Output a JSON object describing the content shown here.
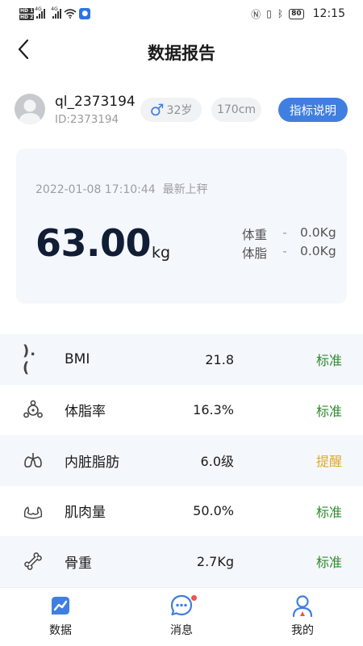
{
  "status_bar": {
    "hd1": "HD 1",
    "hd2": "HD 2",
    "net1": "4G",
    "net2": "4G",
    "battery": "80",
    "time": "12:15"
  },
  "header": {
    "title": "数据报告",
    "back_icon": "chevron-left-icon"
  },
  "profile": {
    "username": "ql_2373194",
    "user_id": "ID:2373194",
    "gender_symbol": "♂",
    "age": "32岁",
    "height": "170cm",
    "explain_button": "指标说明"
  },
  "weight_card": {
    "measure_time": "2022-01-08 17:10:44  最新上秤",
    "weight_value": "63.00",
    "weight_unit": "kg",
    "metrics": [
      {
        "label": "体重",
        "dash": "-",
        "value": "0.0Kg"
      },
      {
        "label": "体脂",
        "dash": "-",
        "value": "0.0Kg"
      }
    ]
  },
  "indicators": [
    {
      "icon": ").(",
      "name": "BMI",
      "value": "21.8",
      "status": "标准",
      "status_color": "#2e8b2e"
    },
    {
      "icon": "body-fat-icon",
      "name": "体脂率",
      "value": "16.3%",
      "status": "标准",
      "status_color": "#2e8b2e"
    },
    {
      "icon": "lungs-icon",
      "name": "内脏脂肪",
      "value": "6.0级",
      "status": "提醒",
      "status_color": "#e0a92a"
    },
    {
      "icon": "muscle-icon",
      "name": "肌肉量",
      "value": "50.0%",
      "status": "标准",
      "status_color": "#2e8b2e"
    },
    {
      "icon": "bone-icon",
      "name": "骨重",
      "value": "2.7Kg",
      "status": "标准",
      "status_color": "#2e8b2e"
    }
  ],
  "bottom_nav": [
    {
      "label": "数据",
      "icon": "chart-icon",
      "active": true
    },
    {
      "label": "消息",
      "icon": "chat-bubble-icon",
      "badge": true
    },
    {
      "label": "我的",
      "icon": "user-icon"
    }
  ],
  "colors": {
    "accent": "#3f7fe0",
    "normal": "#2e8b2e",
    "warning": "#e0a92a",
    "card_bg": "#f4f7fc"
  }
}
